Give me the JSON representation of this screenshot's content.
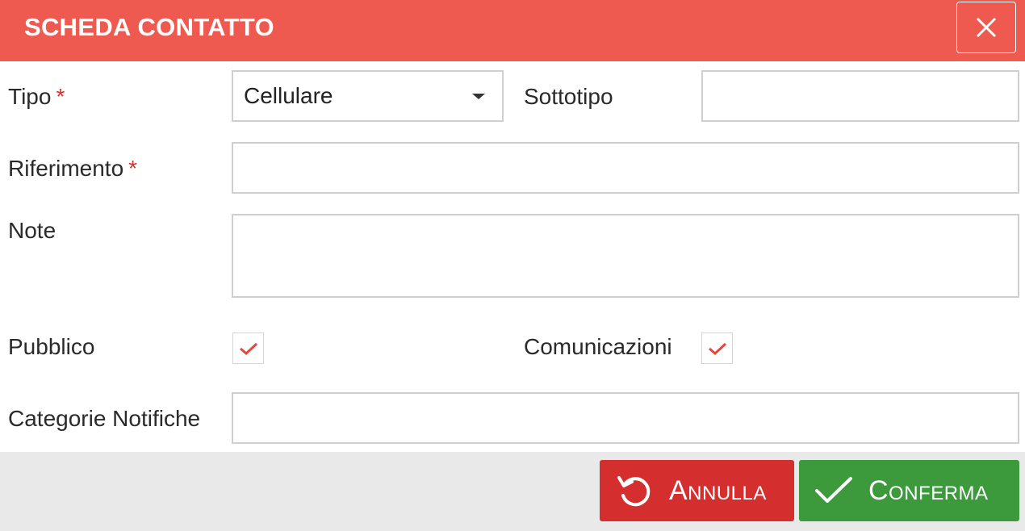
{
  "dialog": {
    "title": "SCHEDA CONTATTO",
    "close_icon": "close-icon"
  },
  "form": {
    "tipo": {
      "label": "Tipo",
      "required_mark": "*",
      "value": "Cellulare"
    },
    "sottotipo": {
      "label": "Sottotipo",
      "value": ""
    },
    "riferimento": {
      "label": "Riferimento",
      "required_mark": "*",
      "value": ""
    },
    "note": {
      "label": "Note",
      "value": ""
    },
    "pubblico": {
      "label": "Pubblico",
      "checked": true
    },
    "comunicazioni": {
      "label": "Comunicazioni",
      "checked": true
    },
    "categorie_notifiche": {
      "label": "Categorie Notifiche",
      "value": ""
    }
  },
  "buttons": {
    "annulla": {
      "label": "Annulla",
      "icon": "undo-icon"
    },
    "conferma": {
      "label": "Conferma",
      "icon": "check-icon"
    }
  },
  "colors": {
    "header": "#ef5a50",
    "required": "#d8322f",
    "checkmark": "#e8453c",
    "annulla": "#d42e2e",
    "conferma": "#3c9a3c",
    "footer": "#e9e9e9"
  }
}
